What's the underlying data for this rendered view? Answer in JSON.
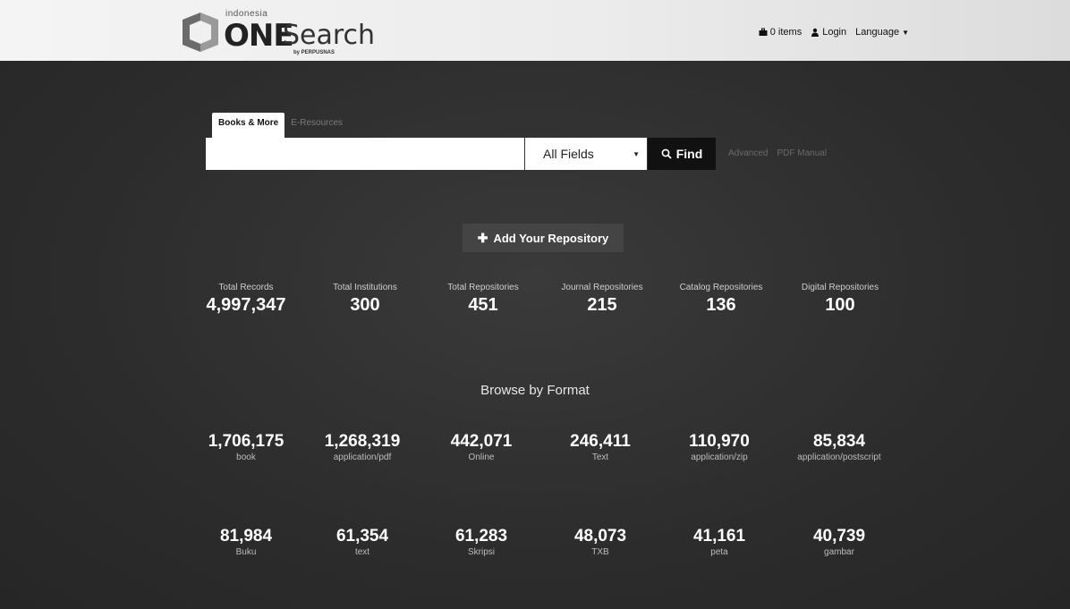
{
  "brand": {
    "small_text": "indonesia",
    "one_text": "ONE",
    "search_text": "Search",
    "by_text": "by PERPUSNAS"
  },
  "topnav": {
    "items_label": "0 items",
    "login_label": "Login",
    "language_label": "Language"
  },
  "search": {
    "tabs": [
      {
        "label": "Books & More",
        "active": true
      },
      {
        "label": "E-Resources",
        "active": false
      }
    ],
    "input_value": "",
    "input_placeholder": "",
    "field_selected": "All Fields",
    "find_label": "Find",
    "advanced_label": "Advanced",
    "pdf_manual_label": "PDF Manual"
  },
  "add_repository_label": "Add Your Repository",
  "stats": [
    {
      "label": "Total Records",
      "value": "4,997,347"
    },
    {
      "label": "Total Institutions",
      "value": "300"
    },
    {
      "label": "Total Repositories",
      "value": "451"
    },
    {
      "label": "Journal Repositories",
      "value": "215"
    },
    {
      "label": "Catalog Repositories",
      "value": "136"
    },
    {
      "label": "Digital Repositories",
      "value": "100"
    }
  ],
  "browse_title": "Browse by Format",
  "formats_row1": [
    {
      "value": "1,706,175",
      "label": "book"
    },
    {
      "value": "1,268,319",
      "label": "application/pdf"
    },
    {
      "value": "442,071",
      "label": "Online"
    },
    {
      "value": "246,411",
      "label": "Text"
    },
    {
      "value": "110,970",
      "label": "application/zip"
    },
    {
      "value": "85,834",
      "label": "application/postscript"
    }
  ],
  "formats_row2": [
    {
      "value": "81,984",
      "label": "Buku"
    },
    {
      "value": "61,354",
      "label": "text"
    },
    {
      "value": "61,283",
      "label": "Skripsi"
    },
    {
      "value": "48,073",
      "label": "TXB"
    },
    {
      "value": "41,161",
      "label": "peta"
    },
    {
      "value": "40,739",
      "label": "gambar"
    }
  ],
  "colors": {
    "header_bg": "#f0f0f0",
    "main_bg": "#2f2f2f",
    "find_bg": "#111111",
    "add_repo_bg": "#444444"
  }
}
